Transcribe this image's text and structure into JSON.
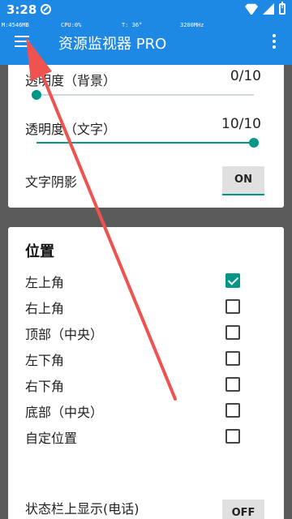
{
  "status_bar": {
    "time": "3:28"
  },
  "overlay_monitor": {
    "mem": "M:4546MB",
    "cpu": "CPU:0%",
    "temp": "T: 36°",
    "freq": "3200MHz"
  },
  "app_bar": {
    "title": "资源监视器 PRO",
    "menu_icon": "hamburger-menu-icon",
    "overflow_icon": "more-vert-icon"
  },
  "appearance": {
    "bg_opacity": {
      "label": "透明度（背景）",
      "value_text": "0/10",
      "value": 0,
      "max": 10
    },
    "text_opacity": {
      "label": "透明度（文字）",
      "value_text": "10/10",
      "value": 10,
      "max": 10
    },
    "text_shadow": {
      "label": "文字阴影",
      "toggle": "ON"
    }
  },
  "position": {
    "title": "位置",
    "options": [
      {
        "label": "左上角",
        "checked": true
      },
      {
        "label": "右上角",
        "checked": false
      },
      {
        "label": "顶部（中央）",
        "checked": false
      },
      {
        "label": "左下角",
        "checked": false
      },
      {
        "label": "右下角",
        "checked": false
      },
      {
        "label": "底部（中央）",
        "checked": false
      },
      {
        "label": "自定位置",
        "checked": false
      }
    ],
    "statusbar_display": {
      "label": "状态栏上显示(电话)",
      "toggle": "OFF"
    }
  },
  "colors": {
    "primary": "#1e88e5",
    "accent": "#009688",
    "arrow": "#ef5350"
  }
}
